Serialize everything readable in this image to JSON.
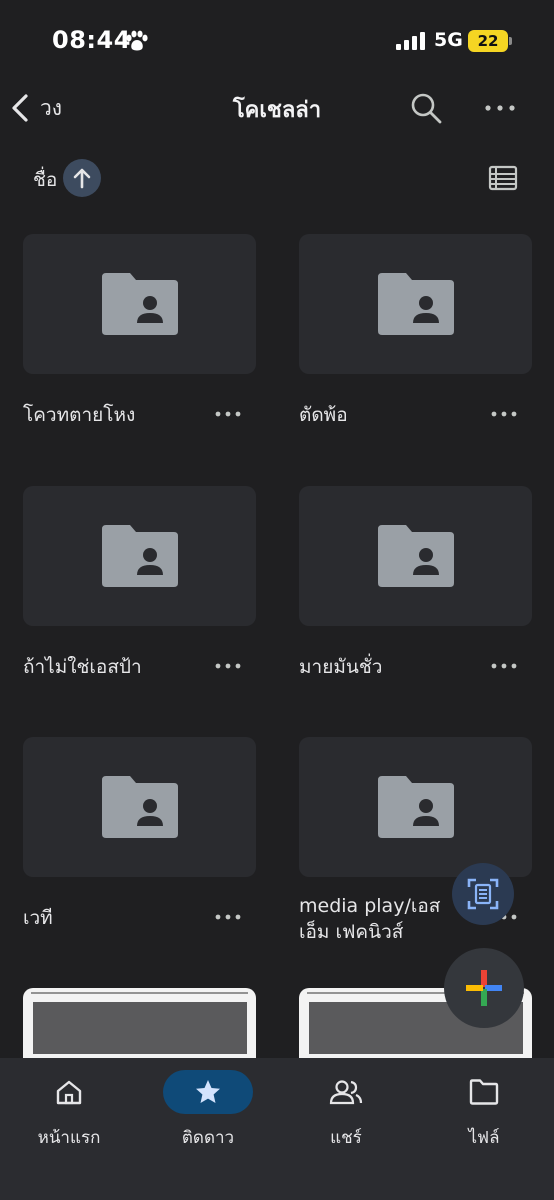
{
  "status_bar": {
    "time": "08:44",
    "network": "5G",
    "battery": "22"
  },
  "appbar": {
    "back_label": "วง",
    "title": "โคเชลล่า"
  },
  "sort": {
    "label": "ชื่อ",
    "direction": "ascending"
  },
  "folders": [
    {
      "name": "โควทตายโหง"
    },
    {
      "name": "ตัดพ้อ"
    },
    {
      "name": "ถ้าไม่ใช่เอสป้า"
    },
    {
      "name": "มายมันชั่ว"
    },
    {
      "name": "เวที"
    },
    {
      "name": "media play/เอสเอ็ม เฟคนิวส์"
    }
  ],
  "bottom_nav": {
    "items": [
      {
        "label": "หน้าแรก",
        "icon": "home-icon",
        "active": false
      },
      {
        "label": "ติดดาว",
        "icon": "star-icon",
        "active": true
      },
      {
        "label": "แชร์",
        "icon": "people-icon",
        "active": false
      },
      {
        "label": "ไฟล์",
        "icon": "folder-icon",
        "active": false
      }
    ]
  },
  "colors": {
    "background": "#1f1f21",
    "card": "#2a2b2f",
    "folder_icon": "#9aa0a6",
    "active_nav": "#0f4a78",
    "sort_chip": "#3d4b5f",
    "fab_scan": "#2b3a52",
    "scan_icon": "#8ab4f8"
  }
}
